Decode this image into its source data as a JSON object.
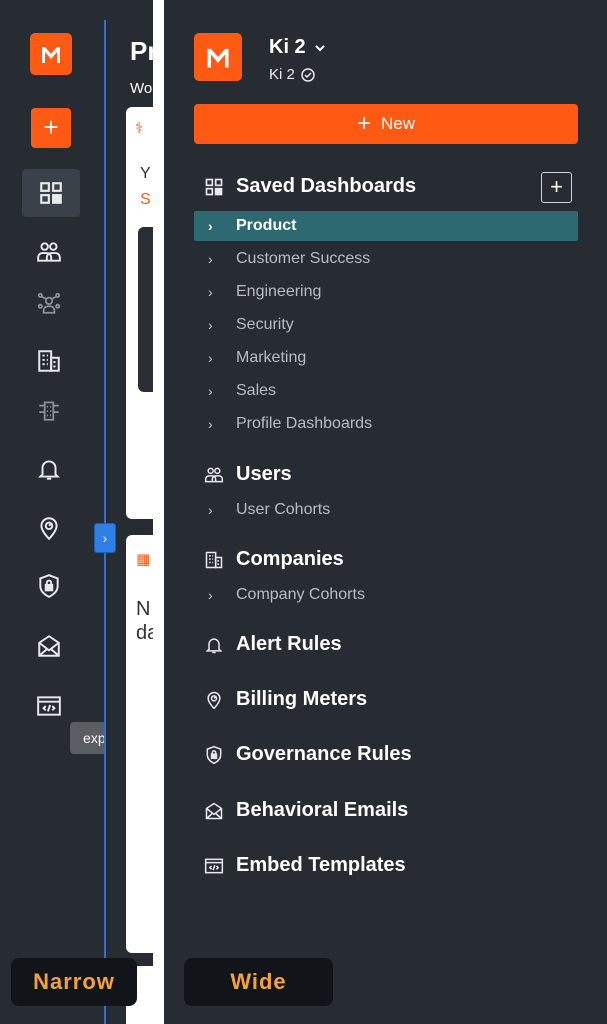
{
  "narrow": {
    "page_title_partial": "Pr",
    "page_sub_partial": "Wo",
    "card_text_y": "Y",
    "card_text_s": "S",
    "card2_text_line1": "N",
    "card2_text_line2": "da",
    "tooltip": "expand",
    "icons": [
      "dashboard-icon",
      "users-icon",
      "user-cohorts-icon",
      "companies-icon",
      "company-cohorts-icon",
      "bell-icon",
      "billing-meter-icon",
      "governance-shield-icon",
      "email-icon",
      "embed-template-icon"
    ],
    "label": "Narrow"
  },
  "wide": {
    "workspace": {
      "name": "Ki 2",
      "sub": "Ki 2"
    },
    "new_button": "New",
    "saved_dashboards": {
      "title": "Saved Dashboards",
      "items": [
        "Product",
        "Customer Success",
        "Engineering",
        "Security",
        "Marketing",
        "Sales",
        "Profile Dashboards"
      ],
      "selected": "Product"
    },
    "users": {
      "title": "Users",
      "items": [
        "User Cohorts"
      ]
    },
    "companies": {
      "title": "Companies",
      "items": [
        "Company Cohorts"
      ]
    },
    "alert_rules": "Alert Rules",
    "billing_meters": "Billing Meters",
    "governance_rules": "Governance Rules",
    "behavioral_emails": "Behavioral Emails",
    "embed_templates": "Embed Templates",
    "label": "Wide"
  },
  "colors": {
    "accent": "#ff5a14",
    "panel": "#272c33",
    "selected": "#2d6970",
    "toggle": "#2f7fe6",
    "tag_text": "#f3a33a"
  }
}
